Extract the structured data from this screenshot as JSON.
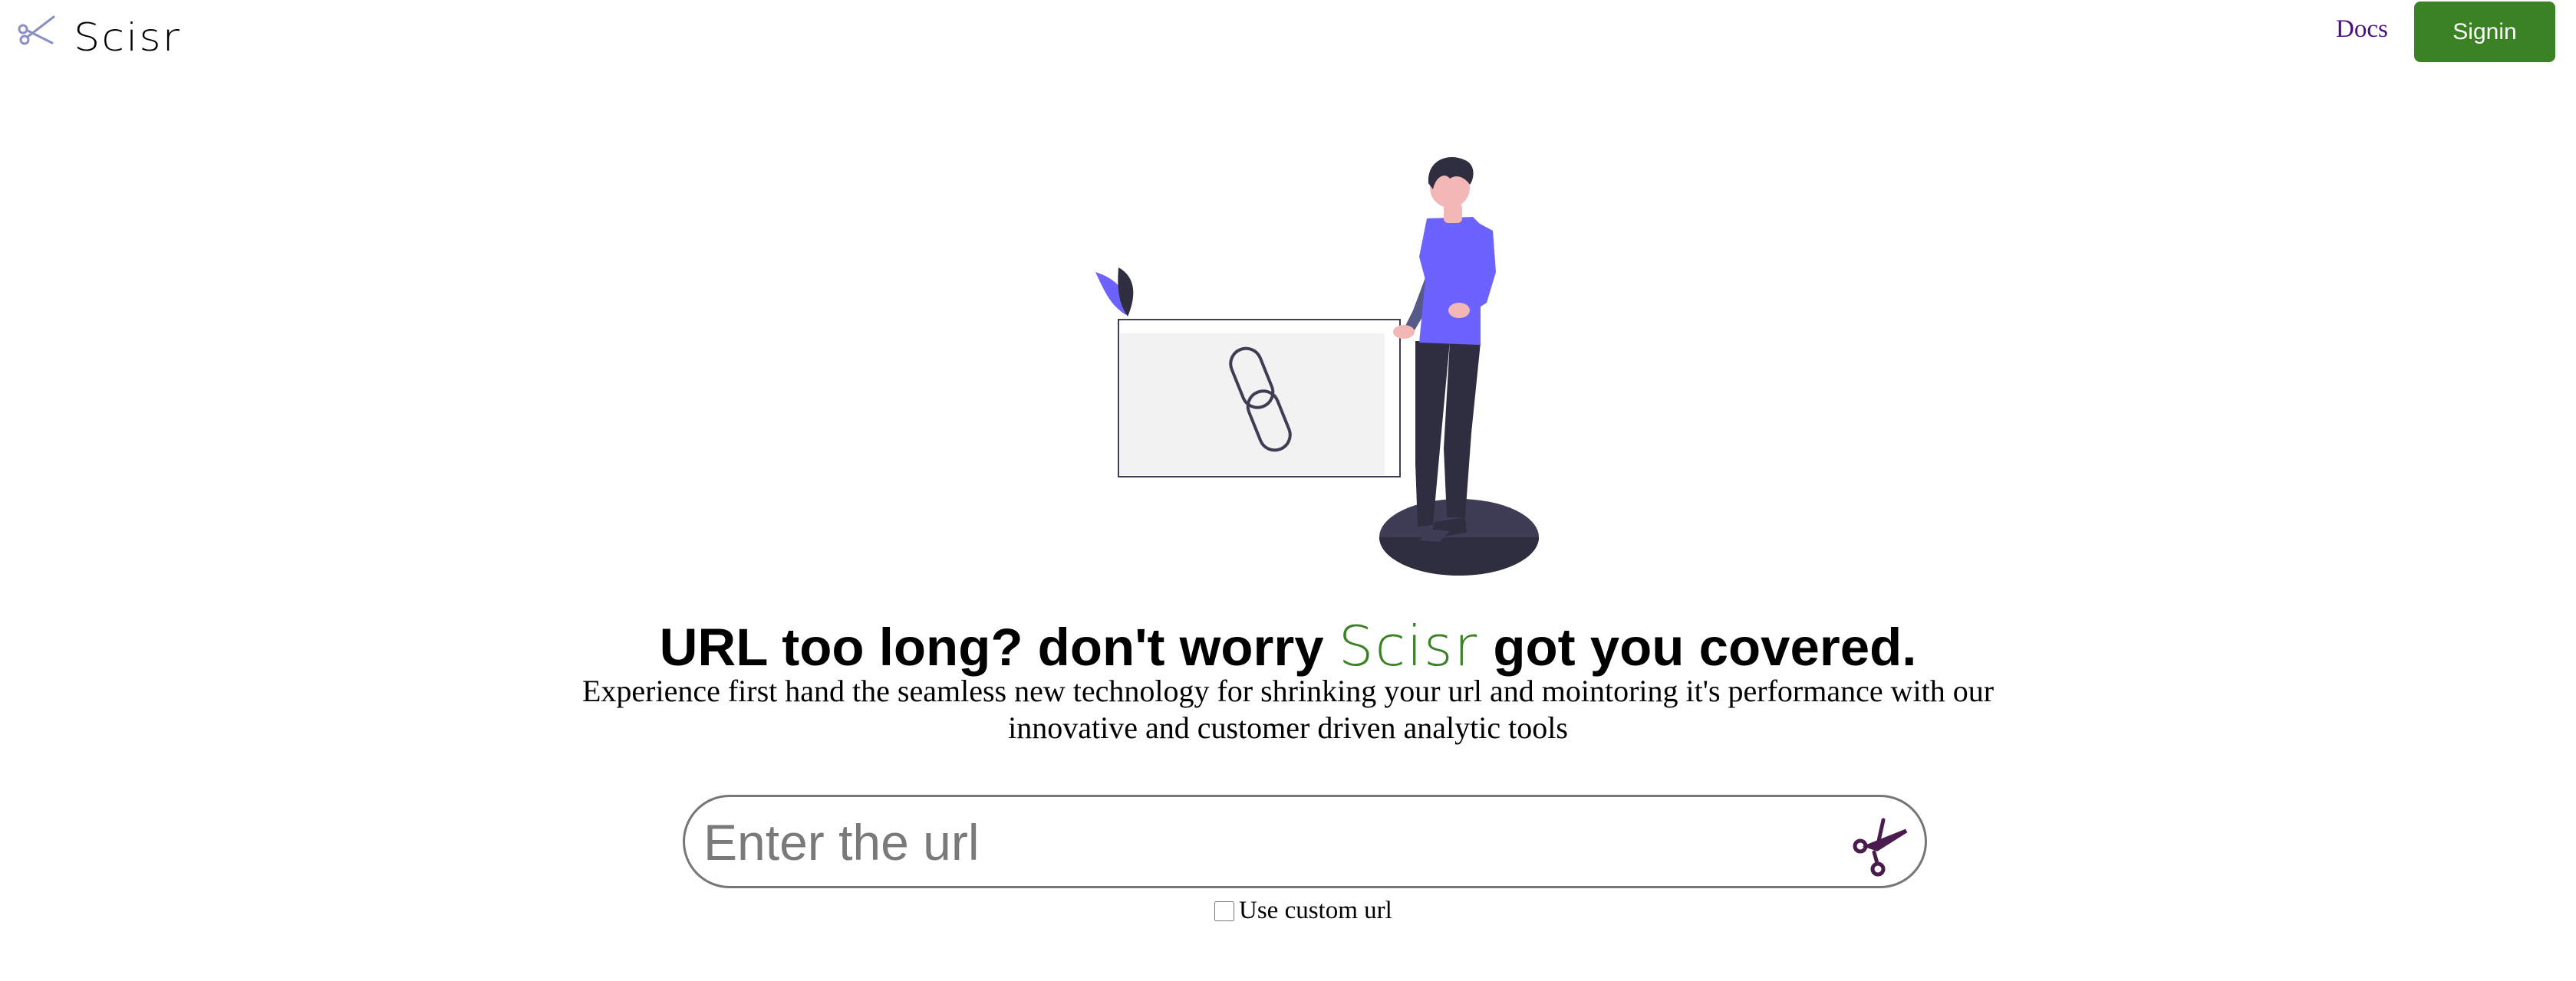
{
  "header": {
    "brand": "Scisr",
    "logo_icon": "scissors-icon",
    "nav_docs": "Docs",
    "signin_label": "Signin"
  },
  "hero": {
    "illustration": "person-with-link-illustration",
    "headline_before": "URL too long? don't worry ",
    "headline_brand": "Scisr",
    "headline_after": " got you covered.",
    "subtitle": "Experience first hand the seamless new technology for shrinking your url and mointoring it's performance with our innovative and customer driven analytic tools"
  },
  "form": {
    "url_placeholder": "Enter the url",
    "url_value": "",
    "submit_icon": "scissors-icon",
    "custom_url_label": "Use custom url",
    "custom_url_checked": false
  },
  "colors": {
    "brand_green": "#3a8224",
    "docs_link": "#4b0f7f",
    "illustration_accent": "#6c63ff",
    "illustration_dark": "#2f2e41",
    "scissors_icon": "#4a1c4e"
  }
}
